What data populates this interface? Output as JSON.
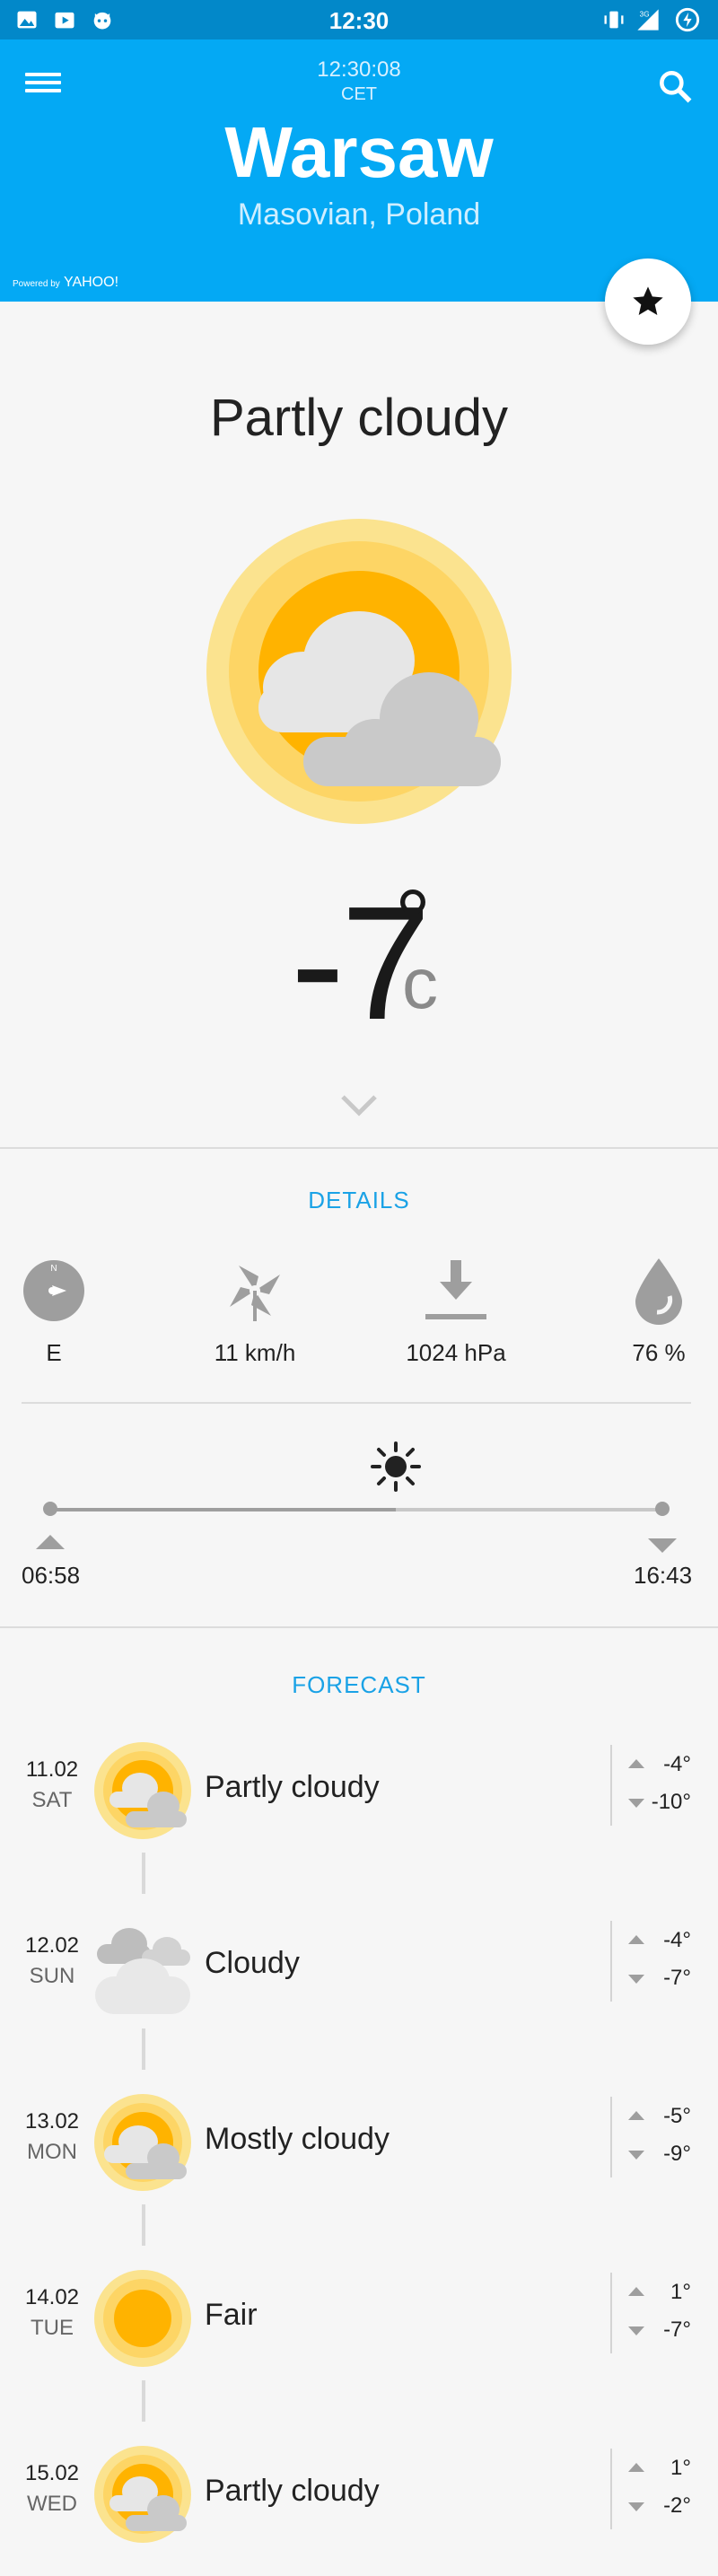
{
  "status_bar": {
    "time": "12:30",
    "network": "3G"
  },
  "header": {
    "clock": "12:30:08",
    "timezone": "CET",
    "city": "Warsaw",
    "region": "Masovian, Poland",
    "powered_prefix": "Powered by",
    "powered_brand": "YAHOO!"
  },
  "current": {
    "condition": "Partly cloudy",
    "temperature": "-7",
    "degree": "°",
    "unit": "c"
  },
  "details": {
    "title": "DETAILS",
    "wind_direction": "E",
    "compass_north": "N",
    "wind_speed": "11 km/h",
    "pressure": "1024 hPa",
    "humidity": "76 %",
    "sunrise": "06:58",
    "sunset": "16:43",
    "day_progress": 0.565
  },
  "forecast": {
    "title": "FORECAST",
    "days": [
      {
        "date": "11.02",
        "day": "SAT",
        "text": "Partly cloudy",
        "high": "-4°",
        "low": "-10°",
        "icon": "partly-cloudy-icon"
      },
      {
        "date": "12.02",
        "day": "SUN",
        "text": "Cloudy",
        "high": "-4°",
        "low": "-7°",
        "icon": "cloudy-icon"
      },
      {
        "date": "13.02",
        "day": "MON",
        "text": "Mostly cloudy",
        "high": "-5°",
        "low": "-9°",
        "icon": "mostly-cloudy-icon"
      },
      {
        "date": "14.02",
        "day": "TUE",
        "text": "Fair",
        "high": "1°",
        "low": "-7°",
        "icon": "fair-sun-icon"
      },
      {
        "date": "15.02",
        "day": "WED",
        "text": "Partly cloudy",
        "high": "1°",
        "low": "-2°",
        "icon": "partly-cloudy-icon"
      }
    ]
  },
  "colors": {
    "header_blue": "#04a9f4",
    "status_blue": "#0288c9",
    "accent": "#1aa2e6",
    "sun_outer": "#fbe38f",
    "sun_inner": "#ffb300"
  }
}
